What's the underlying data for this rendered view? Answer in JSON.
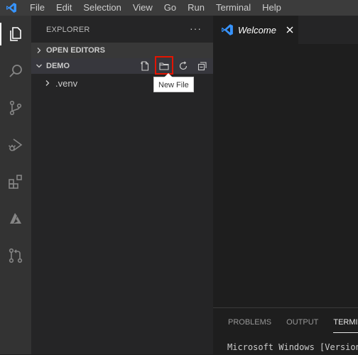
{
  "menu": {
    "items": [
      "File",
      "Edit",
      "Selection",
      "View",
      "Go",
      "Run",
      "Terminal",
      "Help"
    ]
  },
  "activity_bar": {
    "icons": [
      "explorer-icon",
      "search-icon",
      "source-control-icon",
      "run-debug-icon",
      "extensions-icon",
      "azure-icon",
      "pull-requests-icon"
    ],
    "active": "explorer-icon"
  },
  "sidebar": {
    "title": "EXPLORER",
    "more_label": "···",
    "open_editors_label": "OPEN EDITORS",
    "folder_label": "DEMO",
    "tree_items": [
      ".venv"
    ],
    "folder_actions": [
      "new-file-icon",
      "new-folder-icon",
      "refresh-icon",
      "collapse-all-icon"
    ],
    "highlighted_action": "new-folder-icon"
  },
  "tooltip": {
    "text": "New File"
  },
  "editor": {
    "tab_label": "Welcome",
    "tab_close": "✕"
  },
  "panel": {
    "tabs": [
      "PROBLEMS",
      "OUTPUT",
      "TERMINAL"
    ],
    "active_tab": "TERMINAL",
    "terminal_text": "Microsoft Windows [Version"
  },
  "colors": {
    "accent_blue": "#3794ff",
    "highlight_red": "#e51400",
    "titlebar": "#3c3c3c",
    "activity_bar": "#333333",
    "sidebar": "#252526",
    "editor": "#1e1e1e"
  }
}
